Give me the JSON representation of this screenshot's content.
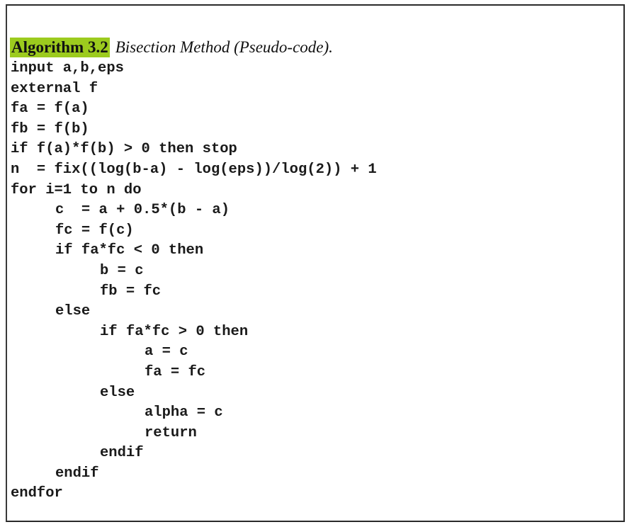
{
  "algorithm": {
    "label": "Algorithm 3.2",
    "title": "Bisection Method (Pseudo-code).",
    "highlight_color": "#9ccb1e",
    "lines": [
      {
        "indent": 0,
        "text": "input a,b,eps"
      },
      {
        "indent": 0,
        "text": "external f"
      },
      {
        "indent": 0,
        "text": "fa = f(a)"
      },
      {
        "indent": 0,
        "text": "fb = f(b)"
      },
      {
        "indent": 0,
        "text": "if f(a)*f(b) > 0 then stop"
      },
      {
        "indent": 0,
        "text": "n  = fix((log(b-a) - log(eps))/log(2)) + 1"
      },
      {
        "indent": 0,
        "text": "for i=1 to n do"
      },
      {
        "indent": 1,
        "text": "c  = a + 0.5*(b - a)"
      },
      {
        "indent": 1,
        "text": "fc = f(c)"
      },
      {
        "indent": 1,
        "text": "if fa*fc < 0 then"
      },
      {
        "indent": 2,
        "text": "b = c"
      },
      {
        "indent": 2,
        "text": "fb = fc"
      },
      {
        "indent": 1,
        "text": "else"
      },
      {
        "indent": 2,
        "text": "if fa*fc > 0 then"
      },
      {
        "indent": 3,
        "text": "a = c"
      },
      {
        "indent": 3,
        "text": "fa = fc"
      },
      {
        "indent": 2,
        "text": "else"
      },
      {
        "indent": 3,
        "text": "alpha = c"
      },
      {
        "indent": 3,
        "text": "return"
      },
      {
        "indent": 2,
        "text": "endif"
      },
      {
        "indent": 1,
        "text": "endif"
      },
      {
        "indent": 0,
        "text": "endfor"
      }
    ]
  }
}
